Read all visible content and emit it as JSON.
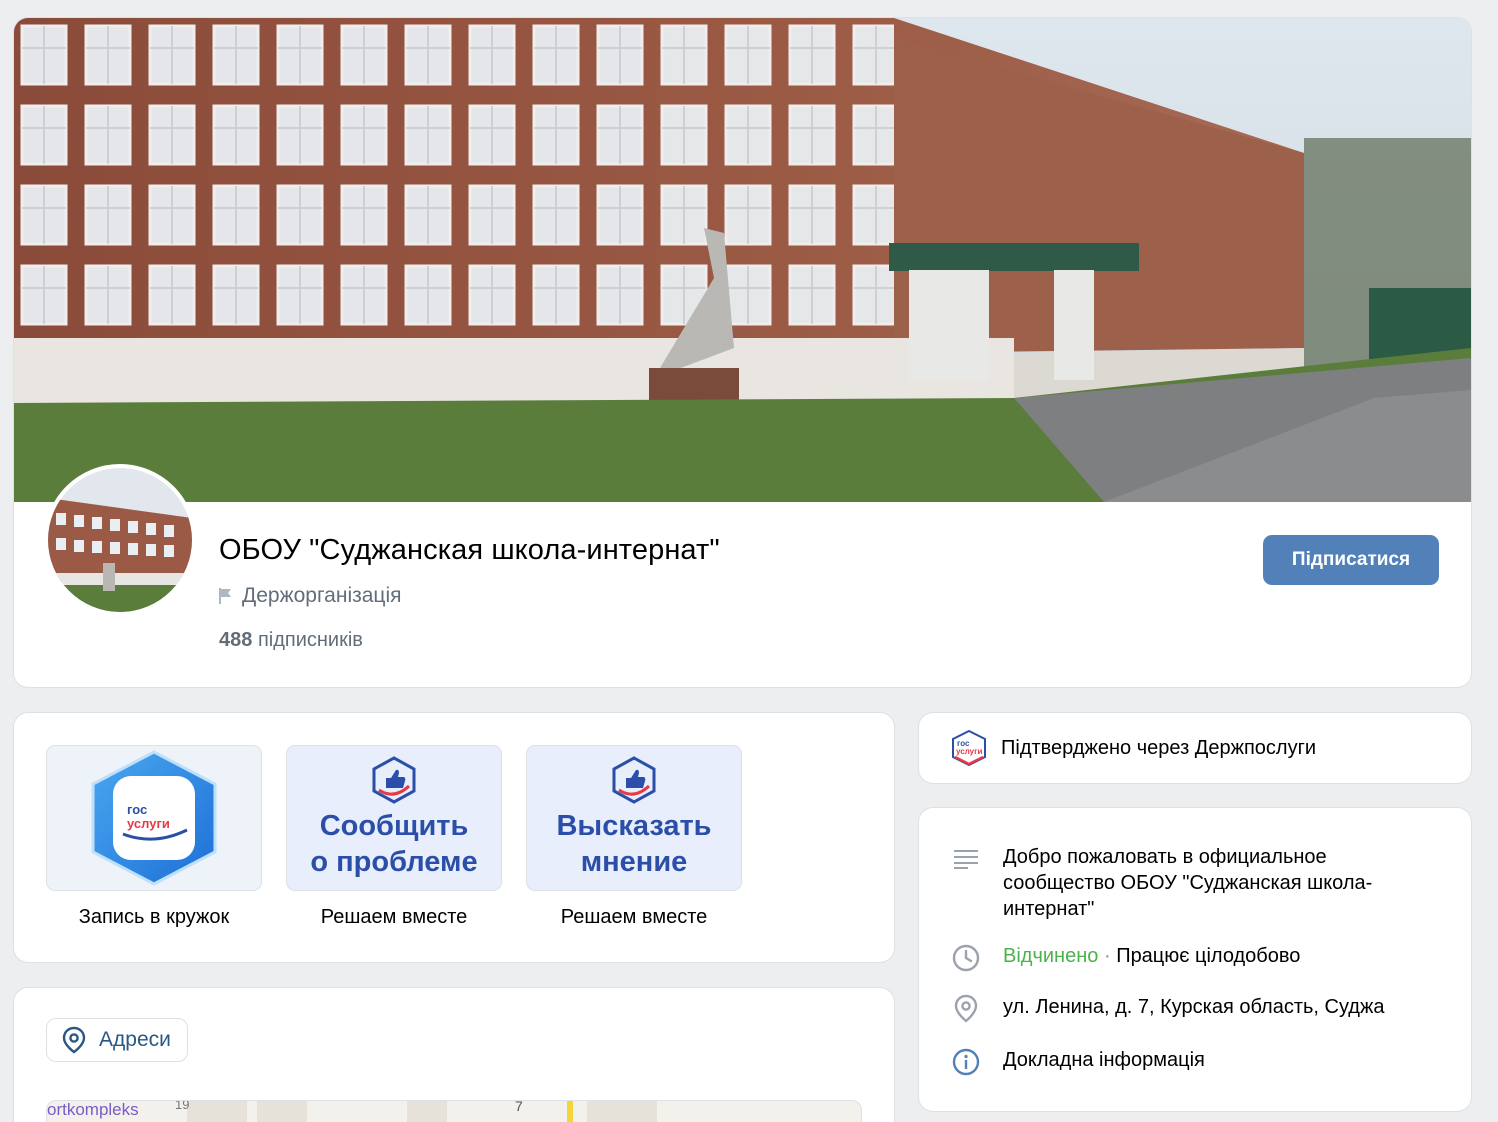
{
  "community": {
    "name": "ОБОУ \"Суджанская школа-интернат\"",
    "type": "Держорганізація",
    "subscribers_count": "488",
    "subscribers_label": "підписників",
    "subscribe_label": "Підписатися"
  },
  "services": {
    "items": [
      {
        "label": "Запись в кружок",
        "logo_top": "гос",
        "logo_bottom": "услуги"
      },
      {
        "label": "Решаем вместе",
        "title_line1": "Сообщить",
        "title_line2": "о проблеме"
      },
      {
        "label": "Решаем вместе",
        "title_line1": "Высказать",
        "title_line2": "мнение"
      }
    ]
  },
  "addresses": {
    "chip_label": "Адреси",
    "map_label": "ortkompleks",
    "map_number_1": "19",
    "map_number_2": "7"
  },
  "verified": {
    "text": "Підтверджено через Держпослуги",
    "logo_top": "гос",
    "logo_bottom": "услуги"
  },
  "info": {
    "description": "Добро пожаловать в официальное сообщество ОБОУ \"Суджанская школа-интернат\"",
    "status_open": "Відчинено",
    "status_separator": "·",
    "hours": "Працює цілодобово",
    "address": "ул. Ленина, д. 7, Курская область, Суджа",
    "details_link": "Докладна інформація"
  },
  "colors": {
    "accent": "#5181b8",
    "link": "#2a5885",
    "open_green": "#4bb34b",
    "background": "#edeef0",
    "gosuslugi_blue": "#2b4fa8",
    "gosuslugi_red": "#e63946"
  },
  "icons": {
    "type": "flag-icon",
    "address_chip": "map-pin-icon",
    "description": "text-lines-icon",
    "hours": "clock-icon",
    "address": "map-pin-icon",
    "details": "info-icon",
    "tile_2": "thumbs-up-icon",
    "tile_3": "thumbs-up-icon"
  }
}
